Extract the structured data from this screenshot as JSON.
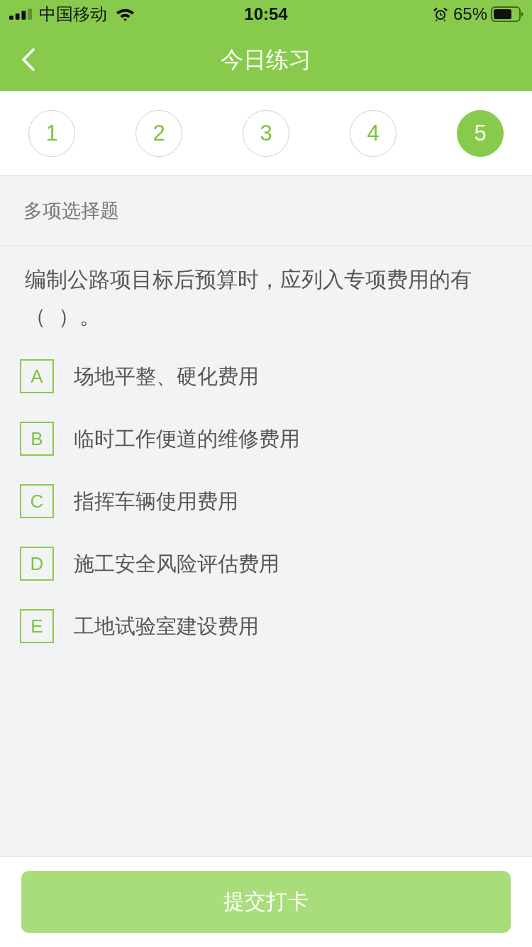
{
  "status_bar": {
    "carrier": "中国移动",
    "time": "10:54",
    "battery": "65%"
  },
  "nav_bar": {
    "title": "今日练习"
  },
  "question_nav": [
    {
      "label": "1",
      "selected": false
    },
    {
      "label": "2",
      "selected": false
    },
    {
      "label": "3",
      "selected": false
    },
    {
      "label": "4",
      "selected": false
    },
    {
      "label": "5",
      "selected": true
    }
  ],
  "question": {
    "type": "多项选择题",
    "text": "编制公路项目标后预算时，应列入专项费用的有（  ）。",
    "options": [
      {
        "letter": "A",
        "text": "场地平整、硬化费用",
        "selected": false
      },
      {
        "letter": "B",
        "text": "临时工作便道的维修费用",
        "selected": false
      },
      {
        "letter": "C",
        "text": "指挥车辆使用费用",
        "selected": false
      },
      {
        "letter": "D",
        "text": "施工安全风险评估费用",
        "selected": false
      },
      {
        "letter": "E",
        "text": "工地试验室建设费用",
        "selected": false
      }
    ]
  },
  "submit_button": {
    "label": "提交打卡",
    "disabled": true
  }
}
